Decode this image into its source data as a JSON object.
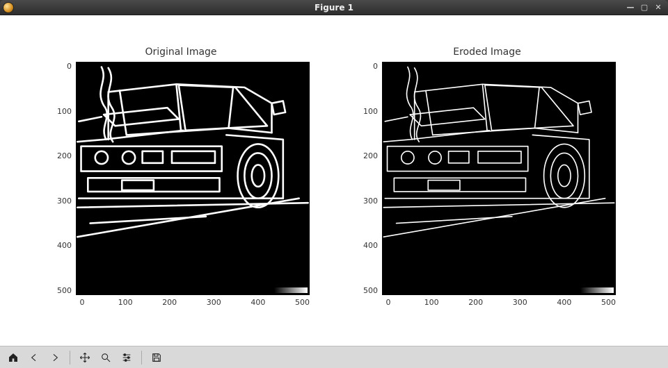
{
  "window": {
    "title": "Figure 1",
    "minimize_glyph": "—",
    "maximize_glyph": "▢",
    "close_glyph": "✕"
  },
  "subplots": [
    {
      "title": "Original Image"
    },
    {
      "title": "Eroded Image"
    }
  ],
  "axis_ticks": {
    "x": [
      "0",
      "100",
      "200",
      "300",
      "400",
      "500"
    ],
    "y": [
      "0",
      "100",
      "200",
      "300",
      "400",
      "500"
    ]
  },
  "toolbar": {
    "home": "Home",
    "back": "Back",
    "forward": "Forward",
    "pan": "Pan",
    "zoom": "Zoom",
    "configure": "Configure subplots",
    "save": "Save"
  },
  "chart_data": [
    {
      "type": "heatmap",
      "title": "Original Image",
      "xlabel": "",
      "ylabel": "",
      "xlim": [
        0,
        512
      ],
      "ylim": [
        512,
        0
      ],
      "xticks": [
        0,
        100,
        200,
        300,
        400,
        500
      ],
      "yticks": [
        0,
        100,
        200,
        300,
        400,
        500
      ],
      "colormap": "gray",
      "description": "Grayscale edge map (white strokes on black) of a sports car, shape approx 512x512"
    },
    {
      "type": "heatmap",
      "title": "Eroded Image",
      "xlabel": "",
      "ylabel": "",
      "xlim": [
        0,
        512
      ],
      "ylim": [
        512,
        0
      ],
      "xticks": [
        0,
        100,
        200,
        300,
        400,
        500
      ],
      "yticks": [
        0,
        100,
        200,
        300,
        400,
        500
      ],
      "colormap": "gray",
      "description": "Same car edge map after morphological erosion; strokes slightly thinner"
    }
  ]
}
